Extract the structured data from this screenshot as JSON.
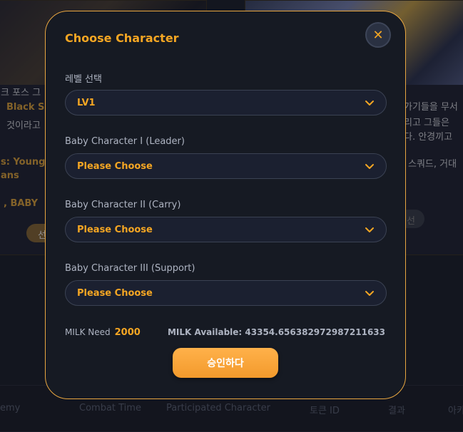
{
  "background": {
    "left_card": {
      "line1": "크 포스 그",
      "line2_gold": "Black Sw",
      "line3": "것이라고",
      "line4_gold": "s: Young B",
      "line5_gold": "ans",
      "line6_gold": ", BABY",
      "pill_text": "선"
    },
    "right_card": {
      "line1": "가기들을 무서",
      "line2": "리고 그들은 ",
      "line3": "다. 안경끼고",
      "line4": "스쿼드, 거대",
      "pill_text": "선"
    },
    "footer": {
      "col1": "emy",
      "col2": "Combat Time",
      "col3": "Participated Character",
      "col4": "토큰 ID",
      "col5": "결과",
      "col6": "아카"
    }
  },
  "modal": {
    "title": "Choose Character",
    "close_symbol": "✕",
    "level": {
      "label": "레벨 선택",
      "value": "LV1"
    },
    "char1": {
      "label": "Baby Character I (Leader)",
      "value": "Please Choose"
    },
    "char2": {
      "label": "Baby Character II (Carry)",
      "value": "Please Choose"
    },
    "char3": {
      "label": "Baby Character III (Support)",
      "value": "Please Choose"
    },
    "milk_need_label": "MILK Need",
    "milk_need_value": "2000",
    "milk_available": "MILK Available: 43354.656382972987211633",
    "approve_label": "승인하다"
  },
  "colors": {
    "accent": "#f5a623",
    "modal_border": "#e8a640",
    "modal_bg": "#161a23"
  },
  "icons": {
    "close": "close-icon",
    "chevron": "chevron-down-icon"
  }
}
